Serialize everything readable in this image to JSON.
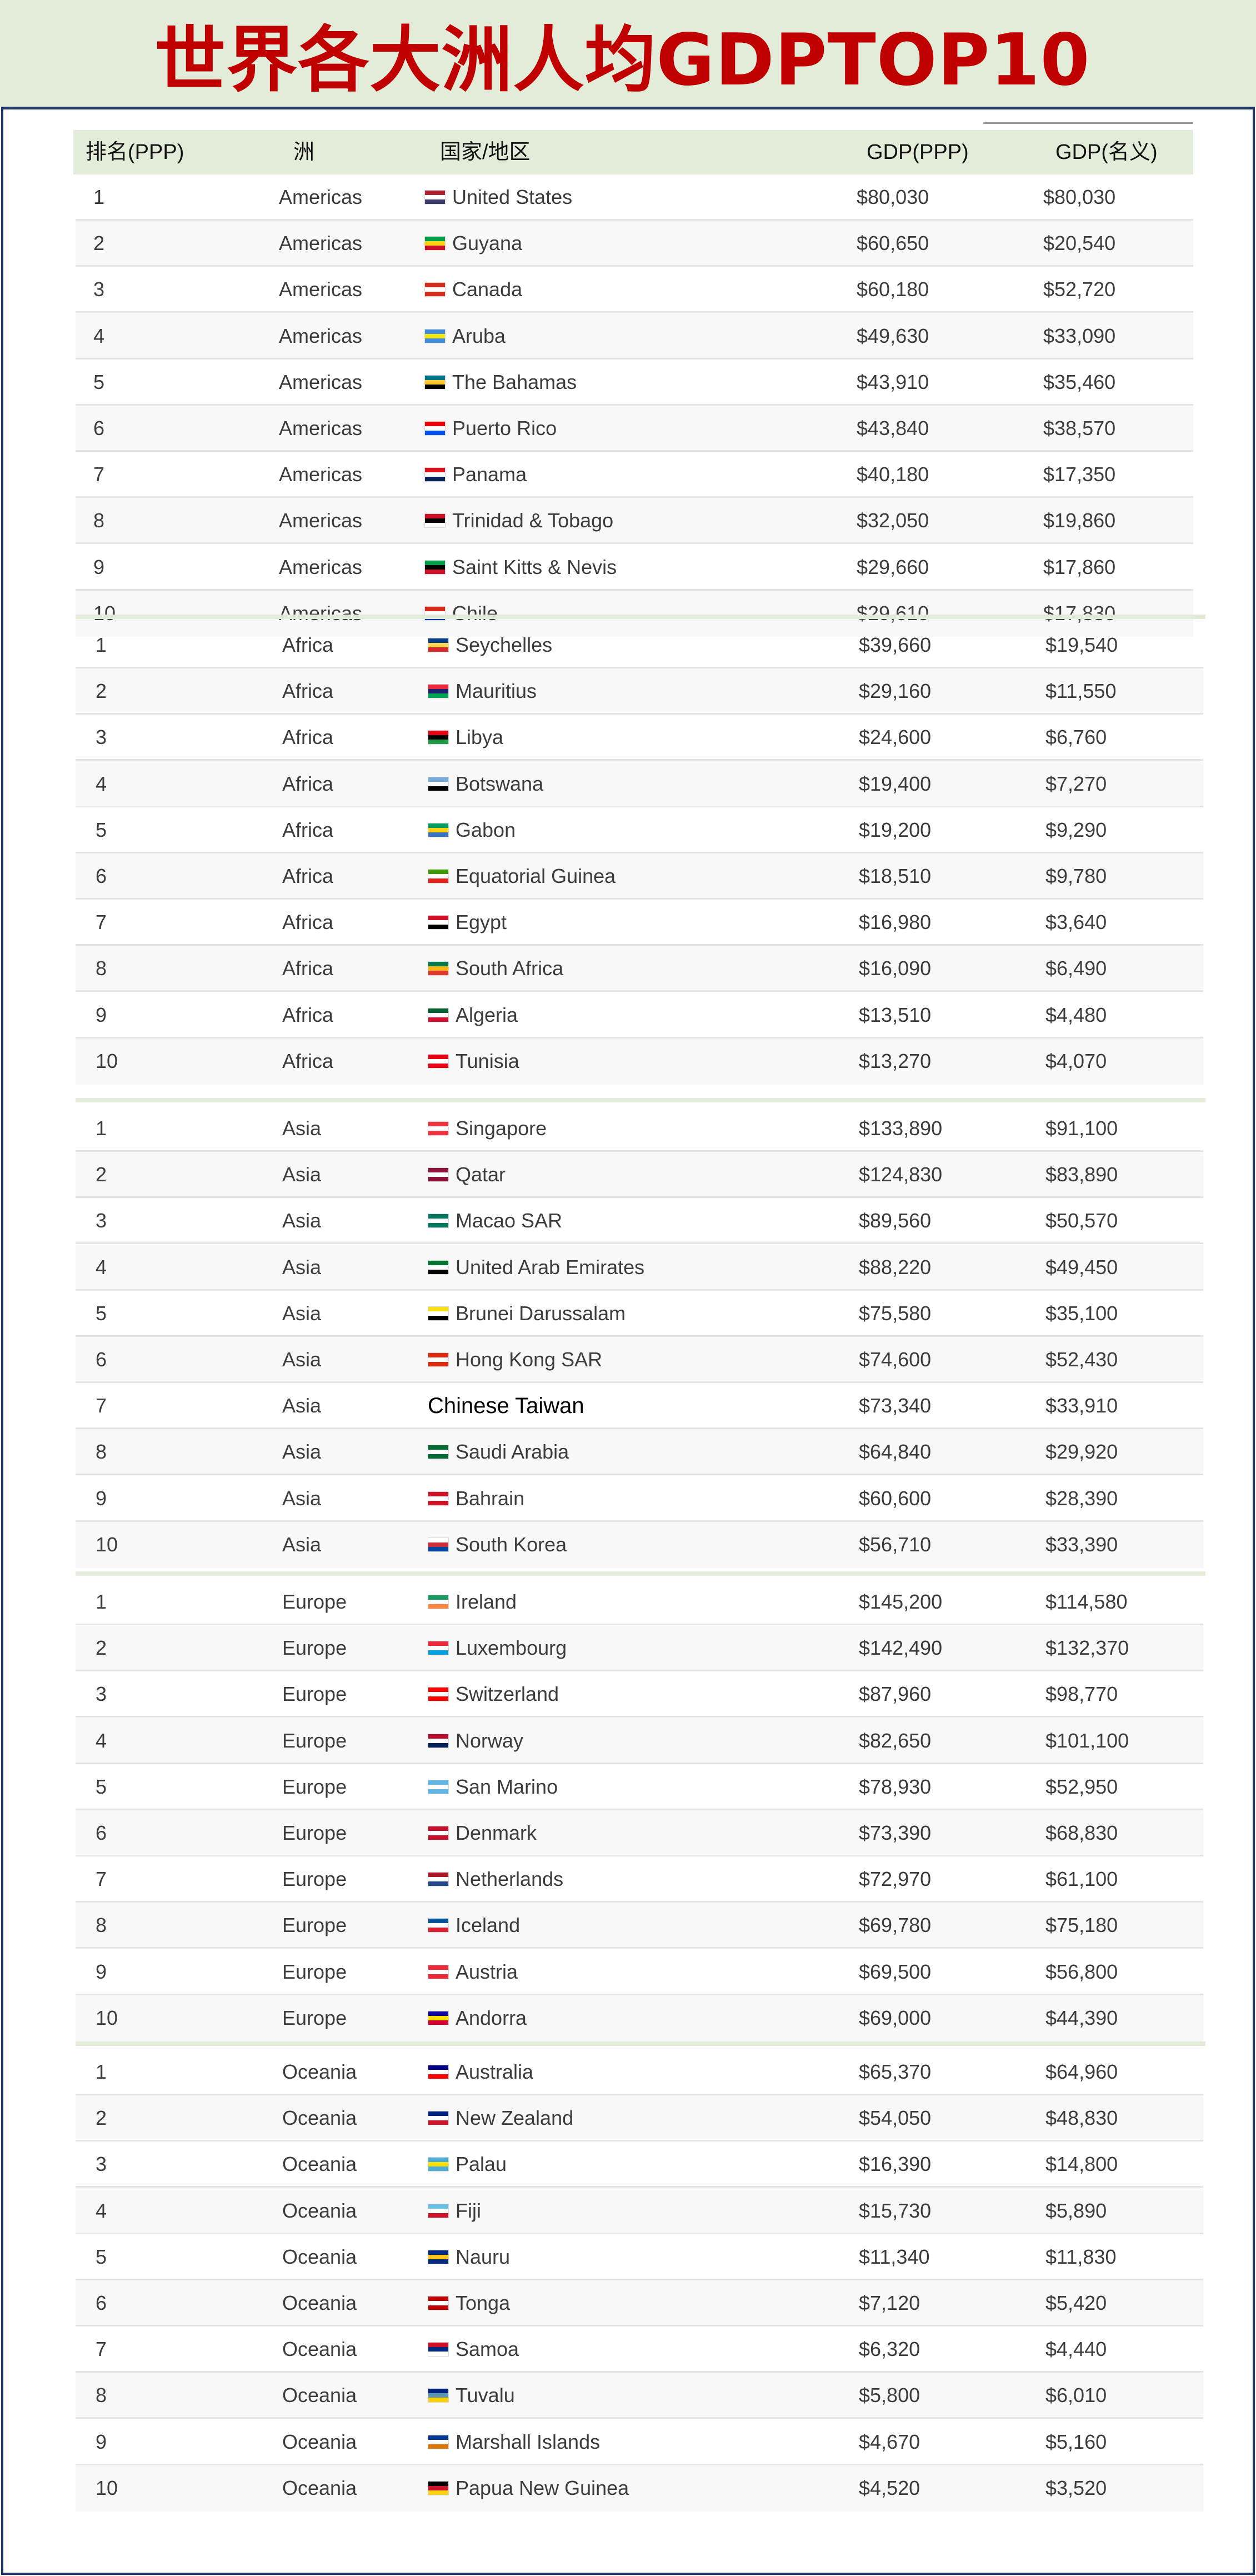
{
  "title": "世界各大洲人均GDPTOP10",
  "columns": {
    "rank": "排名(PPP)",
    "continent": "洲",
    "country": "国家/地区",
    "gdp_ppp": "GDP(PPP)",
    "gdp_nominal": "GDP(名义)"
  },
  "groups": [
    {
      "continent": "Americas",
      "rows": [
        {
          "rank": "1",
          "country": "United States",
          "ppp": "$80,030",
          "nominal": "$80,030"
        },
        {
          "rank": "2",
          "country": "Guyana",
          "ppp": "$60,650",
          "nominal": "$20,540"
        },
        {
          "rank": "3",
          "country": "Canada",
          "ppp": "$60,180",
          "nominal": "$52,720"
        },
        {
          "rank": "4",
          "country": "Aruba",
          "ppp": "$49,630",
          "nominal": "$33,090"
        },
        {
          "rank": "5",
          "country": "The Bahamas",
          "ppp": "$43,910",
          "nominal": "$35,460"
        },
        {
          "rank": "6",
          "country": "Puerto Rico",
          "ppp": "$43,840",
          "nominal": "$38,570"
        },
        {
          "rank": "7",
          "country": "Panama",
          "ppp": "$40,180",
          "nominal": "$17,350"
        },
        {
          "rank": "8",
          "country": "Trinidad & Tobago",
          "ppp": "$32,050",
          "nominal": "$19,860"
        },
        {
          "rank": "9",
          "country": "Saint Kitts & Nevis",
          "ppp": "$29,660",
          "nominal": "$17,860"
        },
        {
          "rank": "10",
          "country": "Chile",
          "ppp": "$29,610",
          "nominal": "$17,830"
        }
      ]
    },
    {
      "continent": "Africa",
      "rows": [
        {
          "rank": "1",
          "country": "Seychelles",
          "ppp": "$39,660",
          "nominal": "$19,540"
        },
        {
          "rank": "2",
          "country": "Mauritius",
          "ppp": "$29,160",
          "nominal": "$11,550"
        },
        {
          "rank": "3",
          "country": "Libya",
          "ppp": "$24,600",
          "nominal": "$6,760"
        },
        {
          "rank": "4",
          "country": "Botswana",
          "ppp": "$19,400",
          "nominal": "$7,270"
        },
        {
          "rank": "5",
          "country": "Gabon",
          "ppp": "$19,200",
          "nominal": "$9,290"
        },
        {
          "rank": "6",
          "country": "Equatorial Guinea",
          "ppp": "$18,510",
          "nominal": "$9,780"
        },
        {
          "rank": "7",
          "country": "Egypt",
          "ppp": "$16,980",
          "nominal": "$3,640"
        },
        {
          "rank": "8",
          "country": "South Africa",
          "ppp": "$16,090",
          "nominal": "$6,490"
        },
        {
          "rank": "9",
          "country": "Algeria",
          "ppp": "$13,510",
          "nominal": "$4,480"
        },
        {
          "rank": "10",
          "country": "Tunisia",
          "ppp": "$13,270",
          "nominal": "$4,070"
        }
      ]
    },
    {
      "continent": "Asia",
      "rows": [
        {
          "rank": "1",
          "country": "Singapore",
          "ppp": "$133,890",
          "nominal": "$91,100"
        },
        {
          "rank": "2",
          "country": "Qatar",
          "ppp": "$124,830",
          "nominal": "$83,890"
        },
        {
          "rank": "3",
          "country": "Macao SAR",
          "ppp": "$89,560",
          "nominal": "$50,570"
        },
        {
          "rank": "4",
          "country": "United Arab Emirates",
          "ppp": "$88,220",
          "nominal": "$49,450"
        },
        {
          "rank": "5",
          "country": "Brunei Darussalam",
          "ppp": "$75,580",
          "nominal": "$35,100"
        },
        {
          "rank": "6",
          "country": "Hong Kong SAR",
          "ppp": "$74,600",
          "nominal": "$52,430"
        },
        {
          "rank": "7",
          "country": "Chinese Taiwan",
          "ppp": "$73,340",
          "nominal": "$33,910"
        },
        {
          "rank": "8",
          "country": "Saudi Arabia",
          "ppp": "$64,840",
          "nominal": "$29,920"
        },
        {
          "rank": "9",
          "country": "Bahrain",
          "ppp": "$60,600",
          "nominal": "$28,390"
        },
        {
          "rank": "10",
          "country": "South Korea",
          "ppp": "$56,710",
          "nominal": "$33,390"
        }
      ]
    },
    {
      "continent": "Europe",
      "rows": [
        {
          "rank": "1",
          "country": "Ireland",
          "ppp": "$145,200",
          "nominal": "$114,580"
        },
        {
          "rank": "2",
          "country": "Luxembourg",
          "ppp": "$142,490",
          "nominal": "$132,370"
        },
        {
          "rank": "3",
          "country": "Switzerland",
          "ppp": "$87,960",
          "nominal": "$98,770"
        },
        {
          "rank": "4",
          "country": "Norway",
          "ppp": "$82,650",
          "nominal": "$101,100"
        },
        {
          "rank": "5",
          "country": "San Marino",
          "ppp": "$78,930",
          "nominal": "$52,950"
        },
        {
          "rank": "6",
          "country": "Denmark",
          "ppp": "$73,390",
          "nominal": "$68,830"
        },
        {
          "rank": "7",
          "country": "Netherlands",
          "ppp": "$72,970",
          "nominal": "$61,100"
        },
        {
          "rank": "8",
          "country": "Iceland",
          "ppp": "$69,780",
          "nominal": "$75,180"
        },
        {
          "rank": "9",
          "country": "Austria",
          "ppp": "$69,500",
          "nominal": "$56,800"
        },
        {
          "rank": "10",
          "country": "Andorra",
          "ppp": "$69,000",
          "nominal": "$44,390"
        }
      ]
    },
    {
      "continent": "Oceania",
      "rows": [
        {
          "rank": "1",
          "country": "Australia",
          "ppp": "$65,370",
          "nominal": "$64,960"
        },
        {
          "rank": "2",
          "country": "New Zealand",
          "ppp": "$54,050",
          "nominal": "$48,830"
        },
        {
          "rank": "3",
          "country": "Palau",
          "ppp": "$16,390",
          "nominal": "$14,800"
        },
        {
          "rank": "4",
          "country": "Fiji",
          "ppp": "$15,730",
          "nominal": "$5,890"
        },
        {
          "rank": "5",
          "country": "Nauru",
          "ppp": "$11,340",
          "nominal": "$11,830"
        },
        {
          "rank": "6",
          "country": "Tonga",
          "ppp": "$7,120",
          "nominal": "$5,420"
        },
        {
          "rank": "7",
          "country": "Samoa",
          "ppp": "$6,320",
          "nominal": "$4,440"
        },
        {
          "rank": "8",
          "country": "Tuvalu",
          "ppp": "$5,800",
          "nominal": "$6,010"
        },
        {
          "rank": "9",
          "country": "Marshall Islands",
          "ppp": "$4,670",
          "nominal": "$5,160"
        },
        {
          "rank": "10",
          "country": "Papua New Guinea",
          "ppp": "$4,520",
          "nominal": "$3,520"
        }
      ]
    }
  ]
}
